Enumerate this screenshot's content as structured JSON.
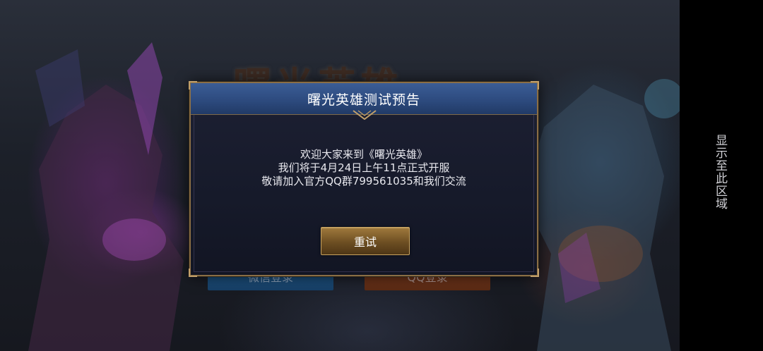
{
  "background": {
    "game_logo_text": "曙光英雄",
    "login_wechat_label": "微信登录",
    "login_qq_label": "QQ登录"
  },
  "side_panel": {
    "label": "显示至此区域"
  },
  "dialog": {
    "title": "曙光英雄测试预告",
    "lines": [
      "欢迎大家来到《曙光英雄》",
      "我们将于4月24日上午11点正式开服",
      "敬请加入官方QQ群799561035和我们交流"
    ],
    "retry_label": "重试"
  },
  "colors": {
    "header_blue": "#2c497c",
    "border_gold": "#8a6e45",
    "button_gold": "#a07a3d",
    "dialog_bg": "#161a2a"
  },
  "icons": [
    "header-ornament-icon"
  ]
}
